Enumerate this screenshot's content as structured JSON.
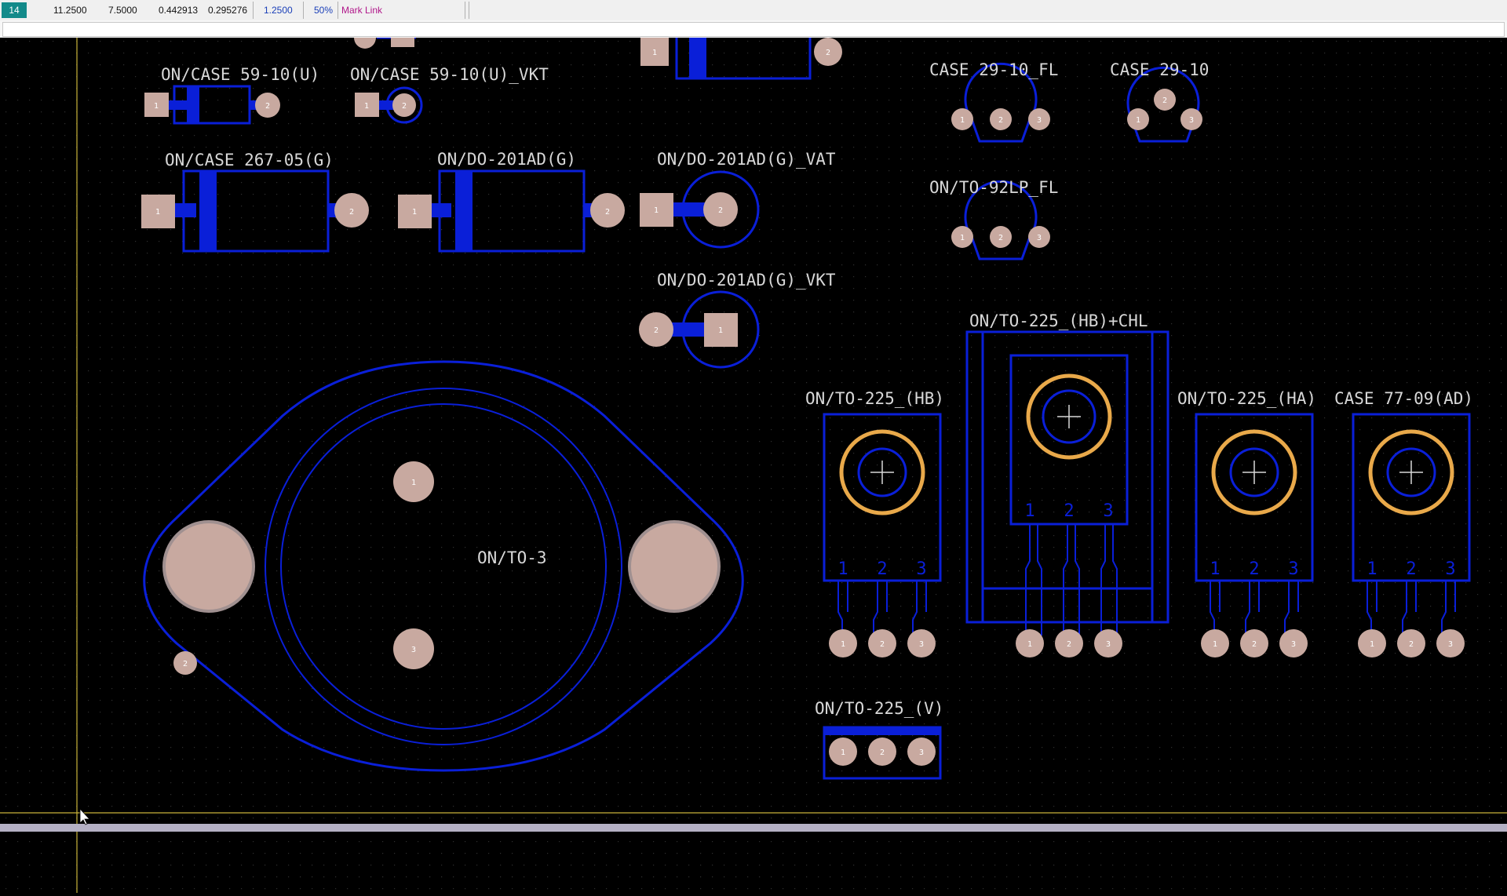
{
  "status_bar": {
    "layer": "14",
    "x": "11.2500",
    "y": "7.5000",
    "x_inch": "0.442913",
    "y_inch": "0.295276",
    "grid": "1.2500",
    "zoom": "50%",
    "mode": "Mark Link"
  },
  "colors": {
    "background": "#000000",
    "outline": "#0a1fd8",
    "pad": "#c8a9a0",
    "ring": "#e9a94a",
    "label": "#d8d8d8",
    "guide": "#c9b43a"
  },
  "footprints": [
    "ON/CASE 59-10(U)",
    "ON/CASE 59-10(U)_VKT",
    "ON/CASE 267-05(G)",
    "ON/DO-201AD(G)",
    "ON/DO-201AD(G)_VAT",
    "ON/DO-201AD(G)_VKT",
    "CASE 29-10_FL",
    "CASE 29-10",
    "ON/TO-92LP_FL",
    "ON/TO-225_(HB)+CHL",
    "ON/TO-225_(HB)",
    "ON/TO-225_(HA)",
    "CASE 77-09(AD)",
    "ON/TO-3",
    "ON/TO-225_(V)"
  ],
  "pin_numbers": [
    "1",
    "2",
    "3"
  ]
}
